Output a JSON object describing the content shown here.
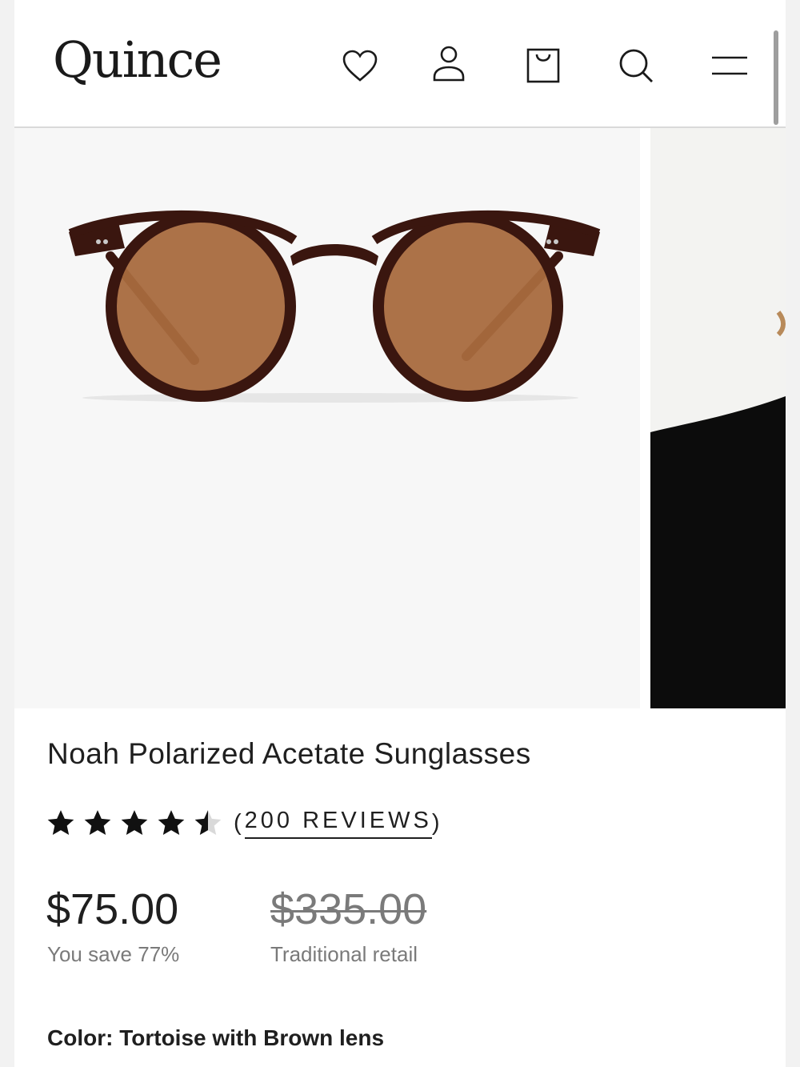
{
  "header": {
    "logo": "Quince",
    "icons": [
      "heart-icon",
      "user-icon",
      "shopping-bag-icon",
      "search-icon",
      "menu-icon"
    ]
  },
  "product": {
    "title": "Noah Polarized Acetate Sunglasses",
    "rating": 4.5,
    "rating_max": 5,
    "reviews_open": "(",
    "reviews_label": "200 REVIEWS",
    "reviews_close": ")",
    "price": "$75.00",
    "savings": "You save 77%",
    "retail_price": "$335.00",
    "retail_label": "Traditional retail",
    "color_label": "Color:",
    "color_value": "Tortoise with Brown lens"
  },
  "colors": {
    "frame": "#3a160f",
    "lens": "#a86a3e",
    "text": "#1f1f1f",
    "muted": "#7a7a7a"
  }
}
